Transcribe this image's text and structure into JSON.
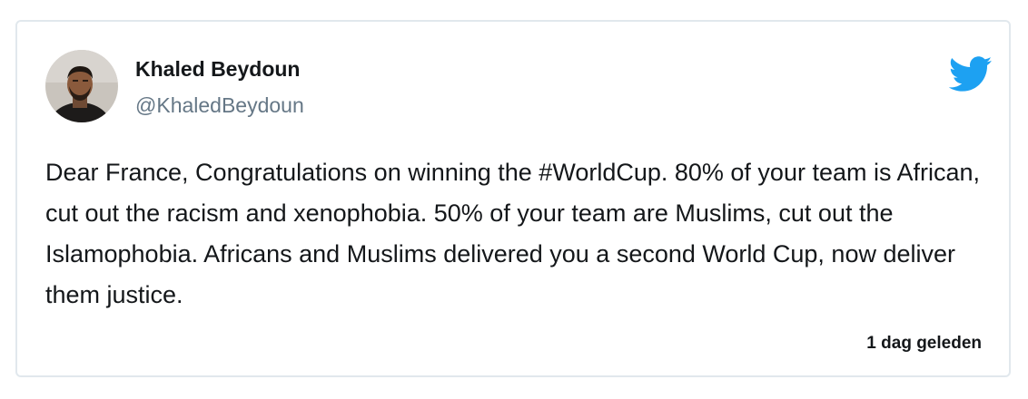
{
  "tweet": {
    "author": {
      "name": "Khaled Beydoun",
      "handle": "@KhaledBeydoun",
      "avatar_icon": "profile-photo"
    },
    "brand_icon": "twitter-bird-icon",
    "brand_color": "#1da1f2",
    "text": "Dear France, Congratulations on winning the #WorldCup. 80% of your team is African, cut out the racism and xenophobia. 50% of your team are Muslims, cut out the Islamophobia. Africans and Muslims delivered you a second World Cup, now deliver them justice.",
    "timestamp": "1 dag geleden"
  }
}
